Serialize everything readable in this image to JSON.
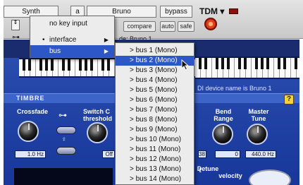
{
  "header": {
    "insert_name": "Synth",
    "slot": "a",
    "preset": "Bruno",
    "bypass_label": "bypass",
    "tdm_label": "TDM ▾",
    "stepper_glyph": "⇕",
    "compare_label": "compare",
    "auto_label": "auto",
    "safe_label": "safe",
    "key_glyph": "⊶",
    "behind_menu_text": "de: Bruno 1"
  },
  "menu": {
    "items": [
      {
        "label": "no key input",
        "bullet": "",
        "arrow": ""
      },
      {
        "label": "interface",
        "bullet": "•",
        "arrow": "▶"
      },
      {
        "label": "bus",
        "bullet": "",
        "arrow": "▶"
      }
    ]
  },
  "submenu": {
    "items": [
      {
        "label": "> bus 1 (Mono)"
      },
      {
        "label": "> bus 2 (Mono)"
      },
      {
        "label": "> bus 3 (Mono)"
      },
      {
        "label": "> bus 4 (Mono)"
      },
      {
        "label": "> bus 5 (Mono)"
      },
      {
        "label": "> bus 6 (Mono)"
      },
      {
        "label": "> bus 7 (Mono)"
      },
      {
        "label": "> bus 8 (Mono)"
      },
      {
        "label": "> bus 9 (Mono)"
      },
      {
        "label": "> bus 10 (Mono)"
      },
      {
        "label": "> bus 11 (Mono)"
      },
      {
        "label": "> bus 12 (Mono)"
      },
      {
        "label": "> bus 13 (Mono)"
      },
      {
        "label": "> bus 14 (Mono)"
      }
    ],
    "selected_index": 1
  },
  "plugin": {
    "midi_text": "DI device name is Bruno 1",
    "help_label": "?",
    "section_title": "TIMBRE",
    "params": {
      "crossfade_label": "Crossfade",
      "crossfade_value": "1.0 Hz",
      "switch_label_1": "Switch C",
      "switch_label_2": "threshold",
      "switch_value": "Off",
      "bend_label_1": "Bend",
      "bend_label_2": "Range",
      "bend_value": "0",
      "bend_left_value": "38",
      "tune_label_1": "Master",
      "tune_label_2": "Tune",
      "tune_value": "440.0 Hz",
      "detune_label": "Detune",
      "detune_sub": "t",
      "velocity_label": "velocity",
      "key_symbol": "⊶",
      "small_symbol": "♀"
    }
  },
  "colors": {
    "menu_highlight": "#2d56c7",
    "plugin_blue": "#2c4fb0"
  }
}
